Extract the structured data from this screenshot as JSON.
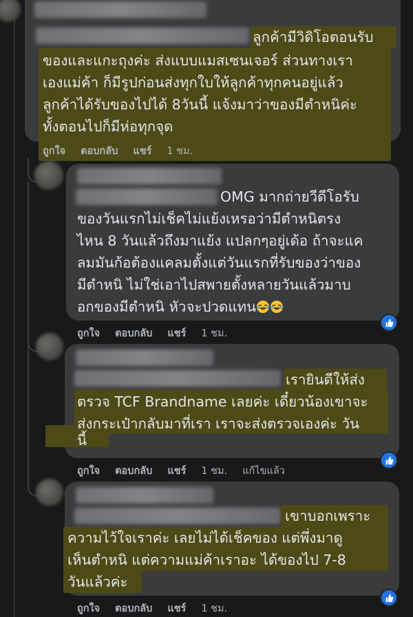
{
  "comments": [
    {
      "lines": [
        "ลูกค้ามีวิดิโอตอนรับ",
        "ของและแกะถุงค่ะ ส่งแบบแมสเซนเจอร์ ส่วนทางเรา",
        "เองแม่ค้า ก็มีรูปก่อนส่งทุกใบให้ลูกค้าทุกคนอยู่แล้ว",
        "ลูกค้าได้รับของไปได้ 8วันนี้ แจ้งมาว่าของมีตำหนิค่ะ",
        "ทั้งตอนไปก็มีห่อทุกจุด"
      ],
      "actions": {
        "like": "ถูกใจ",
        "reply": "ตอบกลับ",
        "share": "แชร์",
        "time": "1 ชม."
      }
    },
    {
      "lines": [
        "OMG มากถ่ายวีดีโอรับ",
        "ของวันแรกไม่เช็คไม่แย้งเหรอว่ามีตำหนิตรง",
        "ไหน 8 วันแล้วถึงมาแย้ง แปลกๆอยู่เด้อ ถ้าจะแค",
        "ลมมันก้อต้องแคลมตั้งแต่วันแรกที่รับของว่าของ",
        "มีตำหนิ ไม่ใช่เอาไปสพายตั้งหลายวันแล้วมาบ",
        "อกของมีตำหนิ หัวจะปวดแทน"
      ],
      "emoji": "laughing-crying-emoji",
      "actions": {
        "like": "ถูกใจ",
        "reply": "ตอบกลับ",
        "share": "แชร์",
        "time": "1 ชม."
      }
    },
    {
      "lines": [
        "เรายินดีให้ส่ง",
        "ตรวจ TCF Brandname เลยค่ะ เดี๋ยวน้องเขาจะ",
        "ส่งกระเป๋ากลับมาที่เรา เราจะส่งตรวจเองค่ะ วัน",
        "นี้"
      ],
      "actions": {
        "like": "ถูกใจ",
        "reply": "ตอบกลับ",
        "share": "แชร์",
        "time": "1 ชม.",
        "edited": "แก้ไขแล้ว"
      }
    },
    {
      "lines": [
        "เขาบอกเพราะ",
        "ความไว้ใจเราค่ะ เลยไม่ได้เช็คของ แต่พึ่งมาดู",
        "เห็นตำหนิ แต่ความแม่ค้าเราอะ ได้ของไป 7-8",
        "วันแล้วค่ะ"
      ],
      "actions": {
        "like": "ถูกใจ",
        "reply": "ตอบกลับ",
        "share": "แชร์",
        "time": "1 ชม."
      }
    }
  ],
  "colors": {
    "background": "#18191a",
    "bubble": "#3a3b3c",
    "highlight": "#4d4a17",
    "text": "#e4e6eb",
    "meta": "#b0b3b8",
    "like_blue": "#2374e1"
  }
}
